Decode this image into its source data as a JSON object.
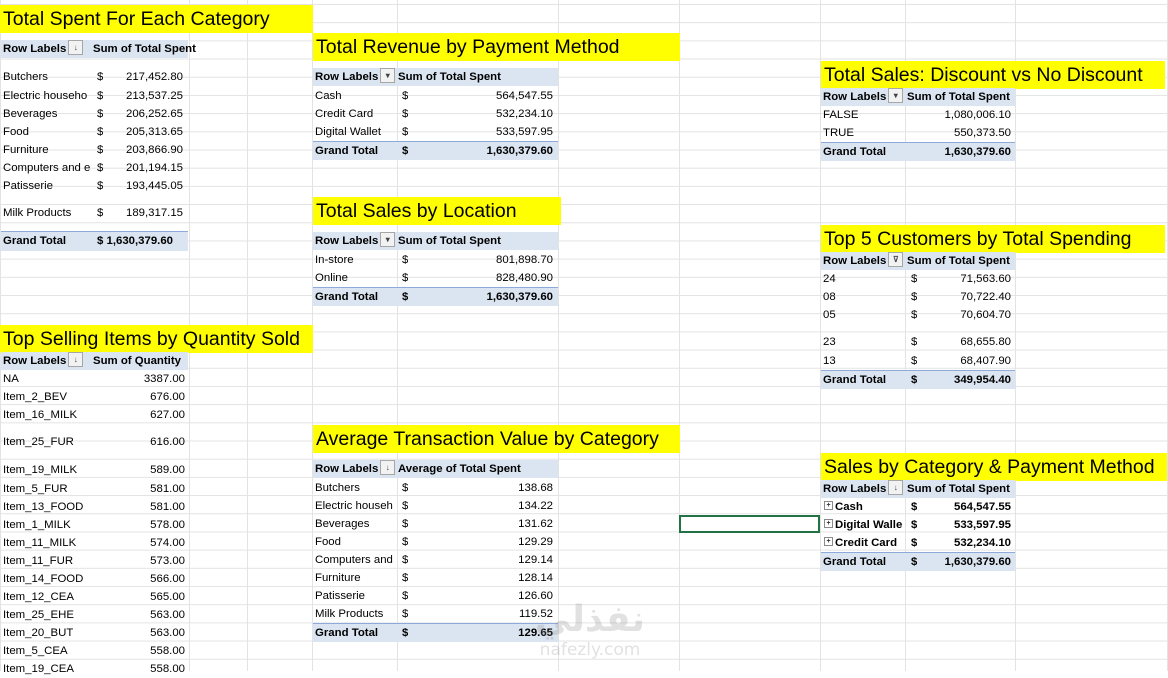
{
  "spent_by_category": {
    "title": "Total Spent For Each Category",
    "headers": [
      "Row Labels",
      "Sum of Total Spent"
    ],
    "rows": [
      {
        "label": "Butchers",
        "cur": "$",
        "value": "217,452.80"
      },
      {
        "label": "Electric househo",
        "cur": "$",
        "value": "213,537.25"
      },
      {
        "label": "Beverages",
        "cur": "$",
        "value": "206,252.65"
      },
      {
        "label": "Food",
        "cur": "$",
        "value": "205,313.65"
      },
      {
        "label": "Furniture",
        "cur": "$",
        "value": "203,866.90"
      },
      {
        "label": "Computers and e",
        "cur": "$",
        "value": "201,194.15"
      },
      {
        "label": "Patisserie",
        "cur": "$",
        "value": "193,445.05"
      },
      {
        "label": "Milk Products",
        "cur": "$",
        "value": "189,317.15"
      }
    ],
    "grand": {
      "label": "Grand Total",
      "value": "$ 1,630,379.60"
    }
  },
  "top_selling": {
    "title": "Top Selling Items by Quantity Sold",
    "headers": [
      "Row Labels",
      "Sum of Quantity"
    ],
    "rows": [
      {
        "label": "NA",
        "value": "3387.00"
      },
      {
        "label": "Item_2_BEV",
        "value": "676.00"
      },
      {
        "label": "Item_16_MILK",
        "value": "627.00"
      },
      {
        "label": "Item_25_FUR",
        "value": "616.00"
      },
      {
        "label": "Item_19_MILK",
        "value": "589.00"
      },
      {
        "label": "Item_5_FUR",
        "value": "581.00"
      },
      {
        "label": "Item_13_FOOD",
        "value": "581.00"
      },
      {
        "label": "Item_1_MILK",
        "value": "578.00"
      },
      {
        "label": "Item_11_MILK",
        "value": "574.00"
      },
      {
        "label": "Item_11_FUR",
        "value": "573.00"
      },
      {
        "label": "Item_14_FOOD",
        "value": "566.00"
      },
      {
        "label": "Item_12_CEA",
        "value": "565.00"
      },
      {
        "label": "Item_25_EHE",
        "value": "563.00"
      },
      {
        "label": "Item_20_BUT",
        "value": "563.00"
      },
      {
        "label": "Item_5_CEA",
        "value": "558.00"
      },
      {
        "label": "Item_19_CEA",
        "value": "558.00"
      }
    ]
  },
  "revenue_by_payment": {
    "title": "Total Revenue by Payment Method",
    "headers": [
      "Row Labels",
      "Sum of Total Spent"
    ],
    "rows": [
      {
        "label": "Cash",
        "cur": "$",
        "value": "564,547.55"
      },
      {
        "label": "Credit Card",
        "cur": "$",
        "value": "532,234.10"
      },
      {
        "label": "Digital Wallet",
        "cur": "$",
        "value": "533,597.95"
      }
    ],
    "grand": {
      "label": "Grand Total",
      "cur": "$",
      "value": "1,630,379.60"
    }
  },
  "sales_by_location": {
    "title": "Total Sales by Location",
    "headers": [
      "Row Labels",
      "Sum of Total Spent"
    ],
    "rows": [
      {
        "label": "In-store",
        "cur": "$",
        "value": "801,898.70"
      },
      {
        "label": "Online",
        "cur": "$",
        "value": "828,480.90"
      }
    ],
    "grand": {
      "label": "Grand Total",
      "cur": "$",
      "value": "1,630,379.60"
    }
  },
  "avg_transaction": {
    "title": "Average Transaction Value by Category",
    "headers": [
      "Row Labels",
      "Average of Total Spent"
    ],
    "rows": [
      {
        "label": "Butchers",
        "cur": "$",
        "value": "138.68"
      },
      {
        "label": "Electric househ",
        "cur": "$",
        "value": "134.22"
      },
      {
        "label": "Beverages",
        "cur": "$",
        "value": "131.62"
      },
      {
        "label": "Food",
        "cur": "$",
        "value": "129.29"
      },
      {
        "label": "Computers and",
        "cur": "$",
        "value": "129.14"
      },
      {
        "label": "Furniture",
        "cur": "$",
        "value": "128.14"
      },
      {
        "label": "Patisserie",
        "cur": "$",
        "value": "126.60"
      },
      {
        "label": "Milk Products",
        "cur": "$",
        "value": "119.52"
      }
    ],
    "grand": {
      "label": "Grand Total",
      "cur": "$",
      "value": "129.65"
    }
  },
  "discount": {
    "title": "Total Sales: Discount vs No Discount",
    "headers": [
      "Row Labels",
      "Sum of Total Spent"
    ],
    "rows": [
      {
        "label": "FALSE",
        "value": "1,080,006.10"
      },
      {
        "label": "TRUE",
        "value": "550,373.50"
      }
    ],
    "grand": {
      "label": "Grand Total",
      "value": "1,630,379.60"
    }
  },
  "top_customers": {
    "title": "Top 5 Customers by Total Spending",
    "headers": [
      "Row Labels",
      "Sum of Total Spent"
    ],
    "rows": [
      {
        "label": "24",
        "cur": "$",
        "value": "71,563.60"
      },
      {
        "label": "08",
        "cur": "$",
        "value": "70,722.40"
      },
      {
        "label": "05",
        "cur": "$",
        "value": "70,604.70"
      },
      {
        "label": "23",
        "cur": "$",
        "value": "68,655.80"
      },
      {
        "label": "13",
        "cur": "$",
        "value": "68,407.90"
      }
    ],
    "grand": {
      "label": "Grand Total",
      "cur": "$",
      "value": "349,954.40"
    }
  },
  "cat_payment": {
    "title": "Sales by Category & Payment Method",
    "headers": [
      "Row Labels",
      "Sum of Total Spent"
    ],
    "rows": [
      {
        "label": "Cash",
        "cur": "$",
        "value": "564,547.55"
      },
      {
        "label": "Digital Walle",
        "cur": "$",
        "value": "533,597.95"
      },
      {
        "label": "Credit Card",
        "cur": "$",
        "value": "532,234.10"
      }
    ],
    "grand": {
      "label": "Grand Total",
      "cur": "$",
      "value": "1,630,379.60"
    }
  },
  "watermark": {
    "arabic": "نفذلي",
    "latin": "nafezly.com"
  },
  "colors": {
    "title_fill": "#ffff00",
    "header_fill": "#dbe5f1",
    "selection": "#217346",
    "grid": "#e3e3e3"
  }
}
